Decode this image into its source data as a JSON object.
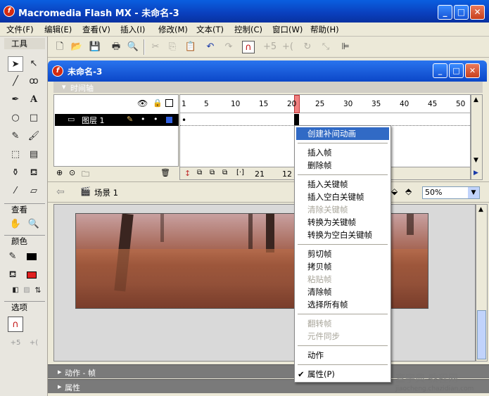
{
  "window": {
    "title": "Macromedia Flash MX - 未命名-3"
  },
  "menu": [
    "文件(F)",
    "编辑(E)",
    "查看(V)",
    "插入(I)",
    "修改(M)",
    "文本(T)",
    "控制(C)",
    "窗口(W)",
    "帮助(H)"
  ],
  "tools_panel": {
    "title": "工具",
    "view_label": "查看",
    "colors_label": "颜色",
    "options_label": "选项",
    "stroke_color": "#000000",
    "fill_color": "#e02020"
  },
  "document": {
    "title": "未命名-3",
    "timeline_label": "时间轴",
    "layer_name": "图层 1",
    "ruler": [
      "1",
      "5",
      "10",
      "15",
      "20",
      "25",
      "30",
      "35",
      "40",
      "45",
      "50"
    ],
    "current_frame": "21",
    "frame_rate_partial": "12",
    "scene": "场景 1",
    "zoom": "50%",
    "panel_actions": "动作 - 帧",
    "panel_properties": "属性"
  },
  "context_menu": {
    "items": [
      {
        "label": "创建补间动画",
        "state": "highlight"
      },
      {
        "label": "插入帧",
        "state": "normal"
      },
      {
        "label": "删除帧",
        "state": "normal"
      },
      {
        "label": "插入关键帧",
        "state": "normal"
      },
      {
        "label": "插入空白关键帧",
        "state": "normal"
      },
      {
        "label": "清除关键帧",
        "state": "disabled"
      },
      {
        "label": "转换为关键帧",
        "state": "normal"
      },
      {
        "label": "转换为空白关键帧",
        "state": "normal"
      },
      {
        "label": "剪切帧",
        "state": "normal"
      },
      {
        "label": "拷贝帧",
        "state": "normal"
      },
      {
        "label": "粘贴帧",
        "state": "disabled"
      },
      {
        "label": "清除帧",
        "state": "normal"
      },
      {
        "label": "选择所有帧",
        "state": "normal"
      },
      {
        "label": "翻转帧",
        "state": "disabled"
      },
      {
        "label": "元件同步",
        "state": "disabled"
      },
      {
        "label": "动作",
        "state": "normal"
      },
      {
        "label": "属性",
        "state": "normal"
      }
    ],
    "checked_suffix": "(P)"
  },
  "watermark": {
    "line1": "查字典 教程网",
    "line2": "jiaocheng.chazidian.com"
  }
}
